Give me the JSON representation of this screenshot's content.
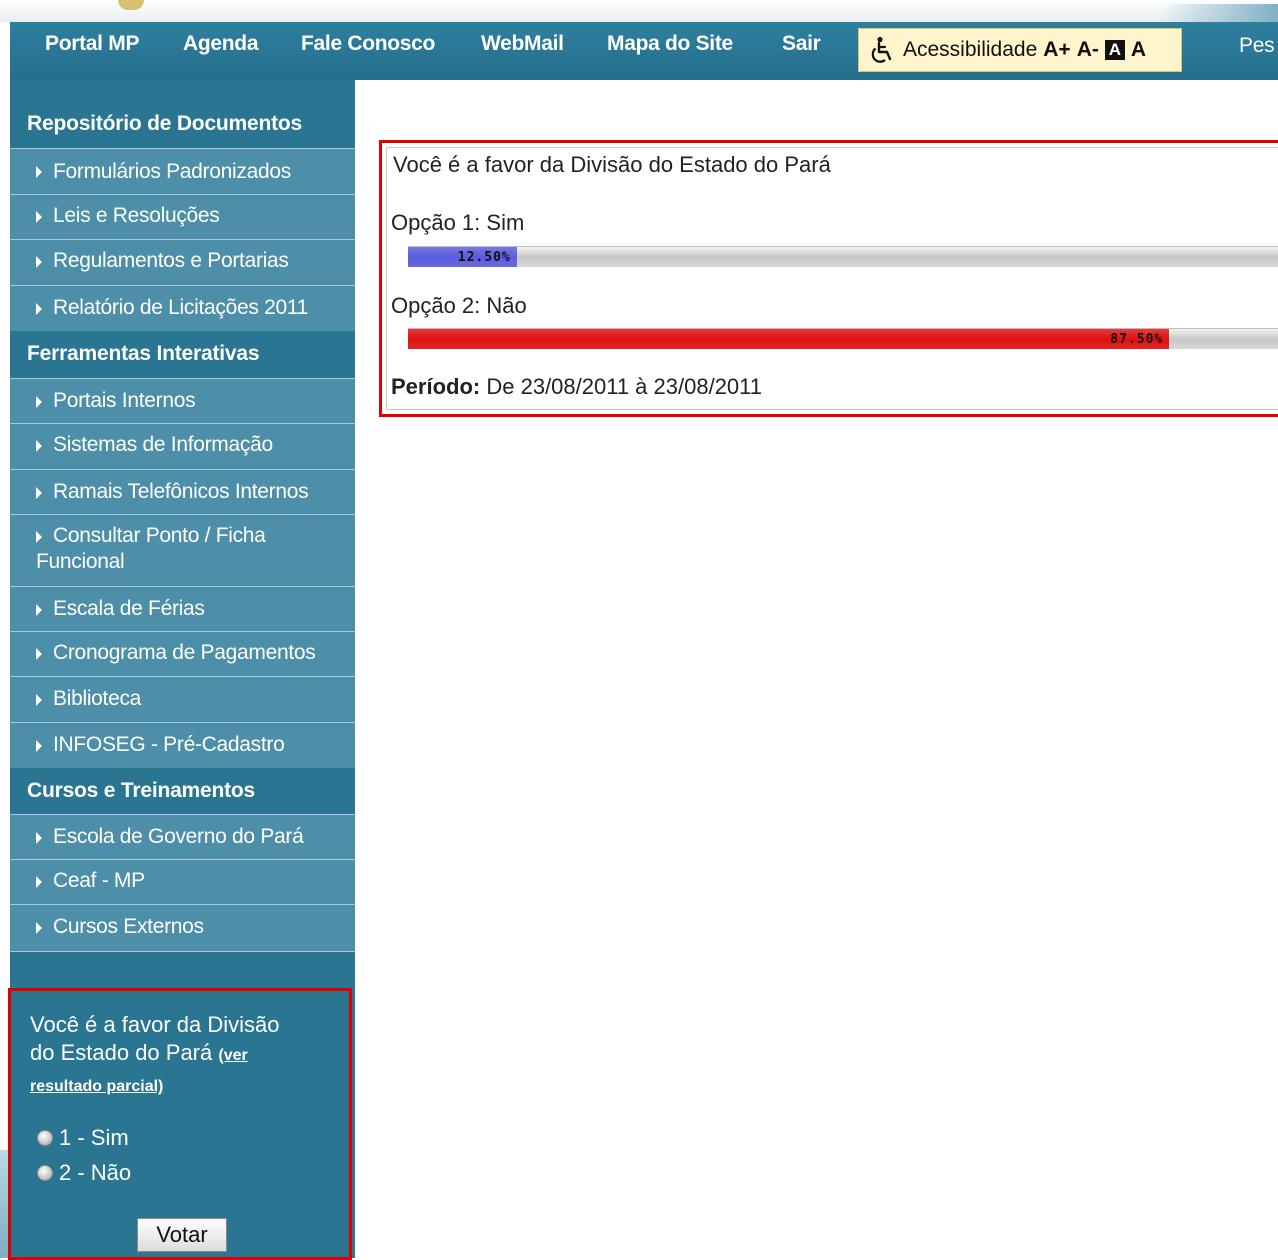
{
  "nav": {
    "items": [
      "Portal MP",
      "Agenda",
      "Fale Conosco",
      "WebMail",
      "Mapa do Site",
      "Sair"
    ],
    "accessibility": {
      "label": "Acessibilidade",
      "increase": "A+",
      "decrease": "A-",
      "contrast": "A",
      "normal": "A"
    },
    "search_partial": "Pes"
  },
  "sidebar": {
    "sections": [
      {
        "title": "Repositório de Documentos",
        "items": [
          "Formulários Padronizados",
          "Leis e Resoluções",
          "Regulamentos e Portarias",
          "Relatório de Licitações 2011"
        ]
      },
      {
        "title": "Ferramentas Interativas",
        "items": [
          "Portais Internos",
          "Sistemas de Informação",
          "Ramais Telefônicos Internos",
          "Consultar Ponto / Ficha Funcional",
          "Escala de Férias",
          "Cronograma de Pagamentos",
          "Biblioteca",
          "INFOSEG - Pré-Cadastro"
        ]
      },
      {
        "title": "Cursos e Treinamentos",
        "items": [
          "Escola de Governo do Pará",
          "Ceaf - MP",
          "Cursos Externos"
        ]
      }
    ],
    "poll": {
      "question": "Você é a favor da Divisão do Estado do Pará",
      "results_link": "(ver resultado parcial)",
      "options": [
        "1 - Sim",
        "2 - Não"
      ],
      "vote_button": "Votar"
    }
  },
  "results": {
    "title": "Você é a favor da Divisão do Estado do Pará",
    "options": [
      {
        "label": "Opção 1: Sim",
        "percent_text": "12.50%",
        "percent": 12.5,
        "color": "#5b5be0"
      },
      {
        "label": "Opção 2: Não",
        "percent_text": "87.50%",
        "percent": 87.5,
        "color": "#e01010"
      }
    ],
    "period_label": "Período:",
    "period_value": "De 23/08/2011 à 23/08/2011"
  }
}
